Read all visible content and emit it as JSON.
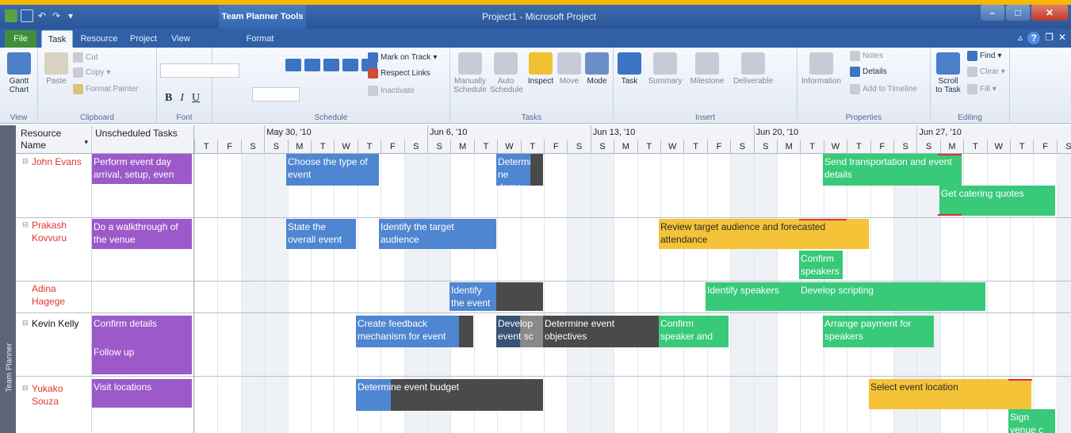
{
  "window": {
    "title": "Project1 - Microsoft Project",
    "contextual_tab": "Team Planner Tools"
  },
  "tabs": {
    "file": "File",
    "task": "Task",
    "resource": "Resource",
    "project": "Project",
    "view": "View",
    "format": "Format"
  },
  "ribbon": {
    "view_group": {
      "gantt": "Gantt\nChart",
      "label": "View"
    },
    "clipboard": {
      "paste": "Paste",
      "cut": "Cut",
      "copy": "Copy",
      "format_painter": "Format Painter",
      "label": "Clipboard"
    },
    "font": {
      "bold": "B",
      "italic": "I",
      "underline": "U",
      "label": "Font"
    },
    "schedule": {
      "mark_on_track": "Mark on Track",
      "respect_links": "Respect Links",
      "inactivate": "Inactivate",
      "label": "Schedule",
      "pct_labels": [
        "0x",
        "25x",
        "50x",
        "75x",
        "100x"
      ]
    },
    "tasks": {
      "manually": "Manually\nSchedule",
      "auto": "Auto\nSchedule",
      "inspect": "Inspect",
      "move": "Move",
      "mode": "Mode",
      "label": "Tasks"
    },
    "insert": {
      "task": "Task",
      "summary": "Summary",
      "milestone": "Milestone",
      "deliverable": "Deliverable",
      "label": "Insert"
    },
    "properties": {
      "information": "Information",
      "notes": "Notes",
      "details": "Details",
      "add_to_timeline": "Add to Timeline",
      "label": "Properties"
    },
    "editing": {
      "scroll_to_task": "Scroll\nto Task",
      "find": "Find",
      "clear": "Clear",
      "fill": "Fill",
      "label": "Editing"
    }
  },
  "sidebar_label": "Team Planner",
  "columns": {
    "resource": "Resource Name",
    "unscheduled": "Unscheduled Tasks"
  },
  "weeks": [
    "May 30, '10",
    "Jun 6, '10",
    "Jun 13, '10",
    "Jun 20, '10",
    "Jun 27, '10"
  ],
  "days": [
    "T",
    "F",
    "S",
    "S",
    "M",
    "T",
    "W",
    "T",
    "F",
    "S",
    "S",
    "M",
    "T",
    "W",
    "T",
    "F",
    "S",
    "S",
    "M",
    "T",
    "W",
    "T",
    "F",
    "S",
    "S",
    "M",
    "T",
    "W",
    "T",
    "F",
    "S",
    "S",
    "M",
    "T",
    "W",
    "T",
    "F",
    "S"
  ],
  "resources": [
    {
      "name": "John Evans",
      "unscheduled": [
        "Perform event day arrival, setup, even"
      ],
      "bars": [
        {
          "text": "Choose the type of event",
          "color": "blue"
        },
        {
          "text": "Determi ne dema",
          "color": "blue"
        },
        {
          "text": "Send transportation and event details",
          "color": "green"
        },
        {
          "text": "Get catering quotes",
          "color": "green"
        }
      ]
    },
    {
      "name": "Prakash Kovvuru",
      "unscheduled": [
        "Do a walkthrough of the venue"
      ],
      "bars": [
        {
          "text": "State the overall event",
          "color": "blue"
        },
        {
          "text": "Identify the target audience",
          "color": "blue"
        },
        {
          "text": "Review target audience and forecasted attendance",
          "color": "yellow"
        },
        {
          "text": "Confirm speakers",
          "color": "green"
        }
      ]
    },
    {
      "name": "Adina Hagege",
      "unscheduled": [],
      "bars": [
        {
          "text": "Identify the event team",
          "color": "blue"
        },
        {
          "text": "Identify speakers",
          "color": "green"
        },
        {
          "text": "Develop scripting",
          "color": "green"
        }
      ]
    },
    {
      "name": "Kevin Kelly",
      "unscheduled": [
        "Confirm details",
        "Follow up"
      ],
      "bars": [
        {
          "text": "Create feedback mechanism for event",
          "color": "blue"
        },
        {
          "text": "Develop event sc",
          "color": "blue"
        },
        {
          "text": "Determine event objectives",
          "color": "dark"
        },
        {
          "text": "Confirm speaker and",
          "color": "green"
        },
        {
          "text": "Arrange payment for speakers",
          "color": "green"
        }
      ]
    },
    {
      "name": "Yukako Souza",
      "unscheduled": [
        "Visit locations"
      ],
      "bars": [
        {
          "text": "Determine event budget",
          "color": "blue"
        },
        {
          "text": "Select event location",
          "color": "yellow"
        },
        {
          "text": "Sign venue c",
          "color": "green"
        }
      ]
    }
  ],
  "colors": {
    "blue": "#4f86d1",
    "purple": "#9b59c9",
    "green": "#38c979",
    "yellow": "#f4c338",
    "dark": "#4a4a4a",
    "accent": "#f6b800"
  }
}
